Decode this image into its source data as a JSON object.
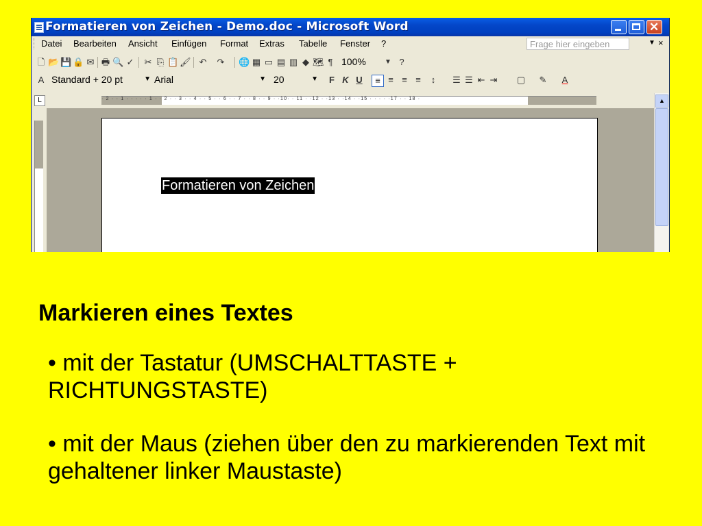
{
  "window": {
    "title": "Formatieren von Zeichen - Demo.doc - Microsoft Word"
  },
  "menu": {
    "items": [
      "Datei",
      "Bearbeiten",
      "Ansicht",
      "Einfügen",
      "Format",
      "Extras",
      "Tabelle",
      "Fenster",
      "?"
    ],
    "help_placeholder": "Frage hier eingeben"
  },
  "toolbar": {
    "zoom": "100%",
    "style": "Standard + 20 pt",
    "font": "Arial",
    "size": "20",
    "bold": "F",
    "italic": "K",
    "underline": "U"
  },
  "ruler": {
    "marks": "· 2 · · 1 · · ·   · · 1 · · 2 · · 3 · · 4 · · 5 · · 6 · · 7 · · 8 · · 9 · ·10· · 11 · ·12 · ·13 · ·14 · ·15 · · ·   · ·17 · · 18 ·"
  },
  "document": {
    "selected_text": "Formatieren von Zeichen"
  },
  "slide": {
    "heading": "Markieren eines Textes",
    "bullets": [
      "• mit der Tastatur (UMSCHALTTASTE + RICHTUNGSTASTE)",
      "• mit der Maus (ziehen über den zu markierenden Text mit gehaltener linker Maustaste)"
    ]
  }
}
